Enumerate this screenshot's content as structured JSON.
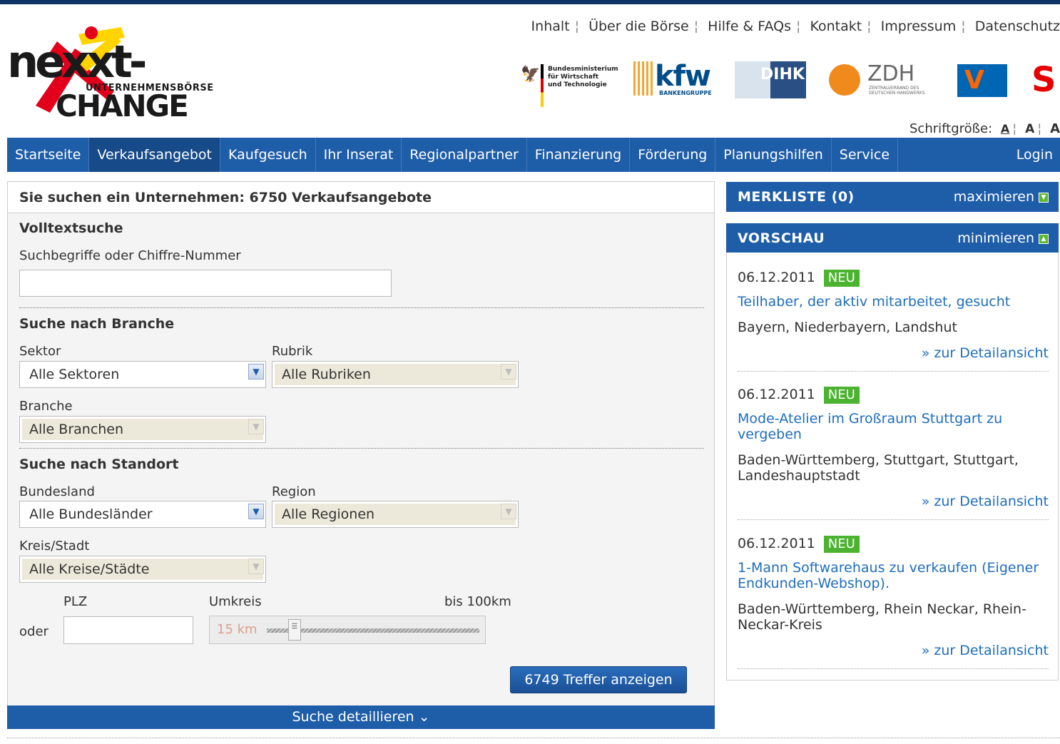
{
  "logo": {
    "main": "nexxt-",
    "sub": "UNTERNEHMENSBÖRSE",
    "change": "CHANGE"
  },
  "metanav": [
    "Inhalt",
    "Über die Börse",
    "Hilfe & FAQs",
    "Kontakt",
    "Impressum",
    "Datenschutz"
  ],
  "partners": {
    "bmwi": "Bundesministerium\nfür Wirtschaft\nund Technologie",
    "kfw": "kfw",
    "kfw_sub": "BANKENGRUPPE",
    "dihk": "DIHK",
    "zdh": "ZDH",
    "zdh_sub": "ZENTRALVERBAND DES DEUTSCHEN HANDWERKS"
  },
  "fontsize": {
    "label": "Schriftgröße:",
    "small": "A",
    "medium": "A",
    "large": "A"
  },
  "mainnav": {
    "items": [
      "Startseite",
      "Verkaufsangebot",
      "Kaufgesuch",
      "Ihr Inserat",
      "Regionalpartner",
      "Finanzierung",
      "Förderung",
      "Planungshilfen",
      "Service"
    ],
    "login": "Login"
  },
  "search": {
    "header": "Sie suchen ein Unternehmen: 6750 Verkaufsangebote",
    "fulltext_title": "Volltextsuche",
    "fulltext_label": "Suchbegriffe oder Chiffre-Nummer",
    "fulltext_value": "",
    "branch_title": "Suche nach Branche",
    "sektor_label": "Sektor",
    "sektor_value": "Alle Sektoren",
    "rubrik_label": "Rubrik",
    "rubrik_value": "Alle Rubriken",
    "branche_label": "Branche",
    "branche_value": "Alle Branchen",
    "location_title": "Suche nach Standort",
    "bundesland_label": "Bundesland",
    "bundesland_value": "Alle Bundesländer",
    "region_label": "Region",
    "region_value": "Alle Regionen",
    "kreis_label": "Kreis/Stadt",
    "kreis_value": "Alle Kreise/Städte",
    "oder_label": "oder",
    "plz_label": "PLZ",
    "plz_value": "",
    "umkreis_label": "Umkreis",
    "umkreis_max": "bis 100km",
    "umkreis_value": "15 km",
    "umkreis_km": 15,
    "submit_label": "6749 Treffer anzeigen",
    "detail_label": "Suche detaillieren ⌄"
  },
  "merkliste": {
    "title": "MERKLISTE (0)",
    "action": "maximieren"
  },
  "vorschau": {
    "title": "VORSCHAU",
    "action": "minimieren",
    "entries": [
      {
        "date": "06.12.2011",
        "badge": "NEU",
        "title": "Teilhaber, der aktiv mitarbeitet, gesucht",
        "location": "Bayern, Niederbayern, Landshut",
        "more": "» zur Detailansicht"
      },
      {
        "date": "06.12.2011",
        "badge": "NEU",
        "title": "Mode-Atelier im Großraum Stuttgart zu vergeben",
        "location": "Baden-Württemberg, Stuttgart, Stuttgart, Landeshauptstadt",
        "more": "» zur Detailansicht"
      },
      {
        "date": "06.12.2011",
        "badge": "NEU",
        "title": "1-Mann Softwarehaus zu verkaufen (Eigener Endkunden-Webshop).",
        "location": "Baden-Württemberg, Rhein Neckar, Rhein-Neckar-Kreis",
        "more": "» zur Detailansicht"
      }
    ]
  },
  "colors": {
    "nav": "#1e5da8",
    "topbar": "#0d3566",
    "badge": "#4bb32f",
    "link": "#1e6dbd"
  }
}
